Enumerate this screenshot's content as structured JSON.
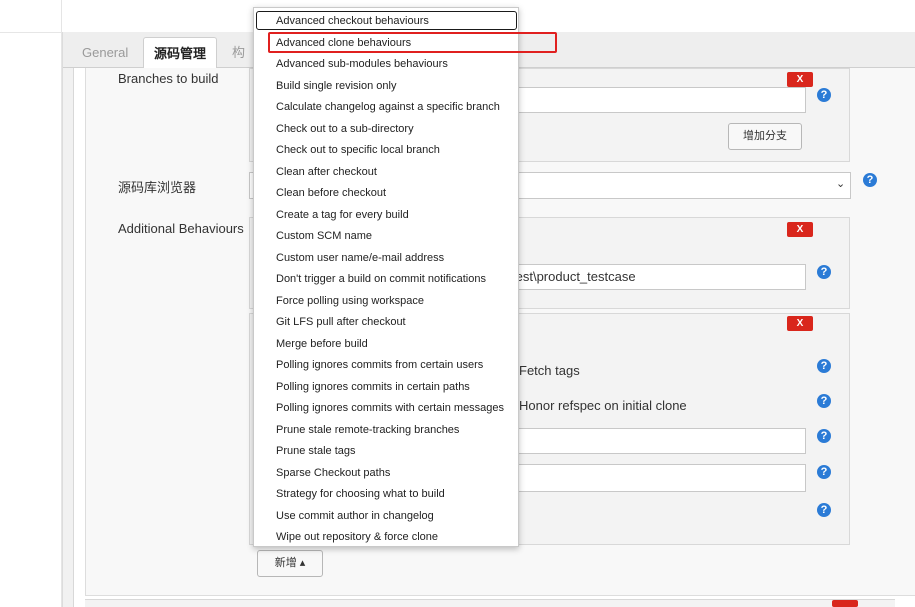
{
  "tabs": {
    "general": "General",
    "scm": "源码管理",
    "more": "构"
  },
  "fields": {
    "branches_label": "Branches to build",
    "add_branch_button": "增加分支",
    "browser_label": "源码库浏览器",
    "additional_behaviours_label": "Additional Behaviours",
    "path_value": "test\\product_testcase",
    "fetch_tags_label": "Fetch tags",
    "honor_refspec_label": "Honor refspec on initial clone",
    "delete_label": "X",
    "help_label": "?",
    "add_button": "新增"
  },
  "menu": {
    "items": [
      "Advanced checkout behaviours",
      "Advanced clone behaviours",
      "Advanced sub-modules behaviours",
      "Build single revision only",
      "Calculate changelog against a specific branch",
      "Check out to a sub-directory",
      "Check out to specific local branch",
      "Clean after checkout",
      "Clean before checkout",
      "Create a tag for every build",
      "Custom SCM name",
      "Custom user name/e-mail address",
      "Don't trigger a build on commit notifications",
      "Force polling using workspace",
      "Git LFS pull after checkout",
      "Merge before build",
      "Polling ignores commits from certain users",
      "Polling ignores commits in certain paths",
      "Polling ignores commits with certain messages",
      "Prune stale remote-tracking branches",
      "Prune stale tags",
      "Sparse Checkout paths",
      "Strategy for choosing what to build",
      "Use commit author in changelog",
      "Wipe out repository & force clone"
    ]
  },
  "colors": {
    "delete_red": "#d9261c",
    "help_blue": "#2b7bd6",
    "highlight_red": "#e0201f"
  }
}
